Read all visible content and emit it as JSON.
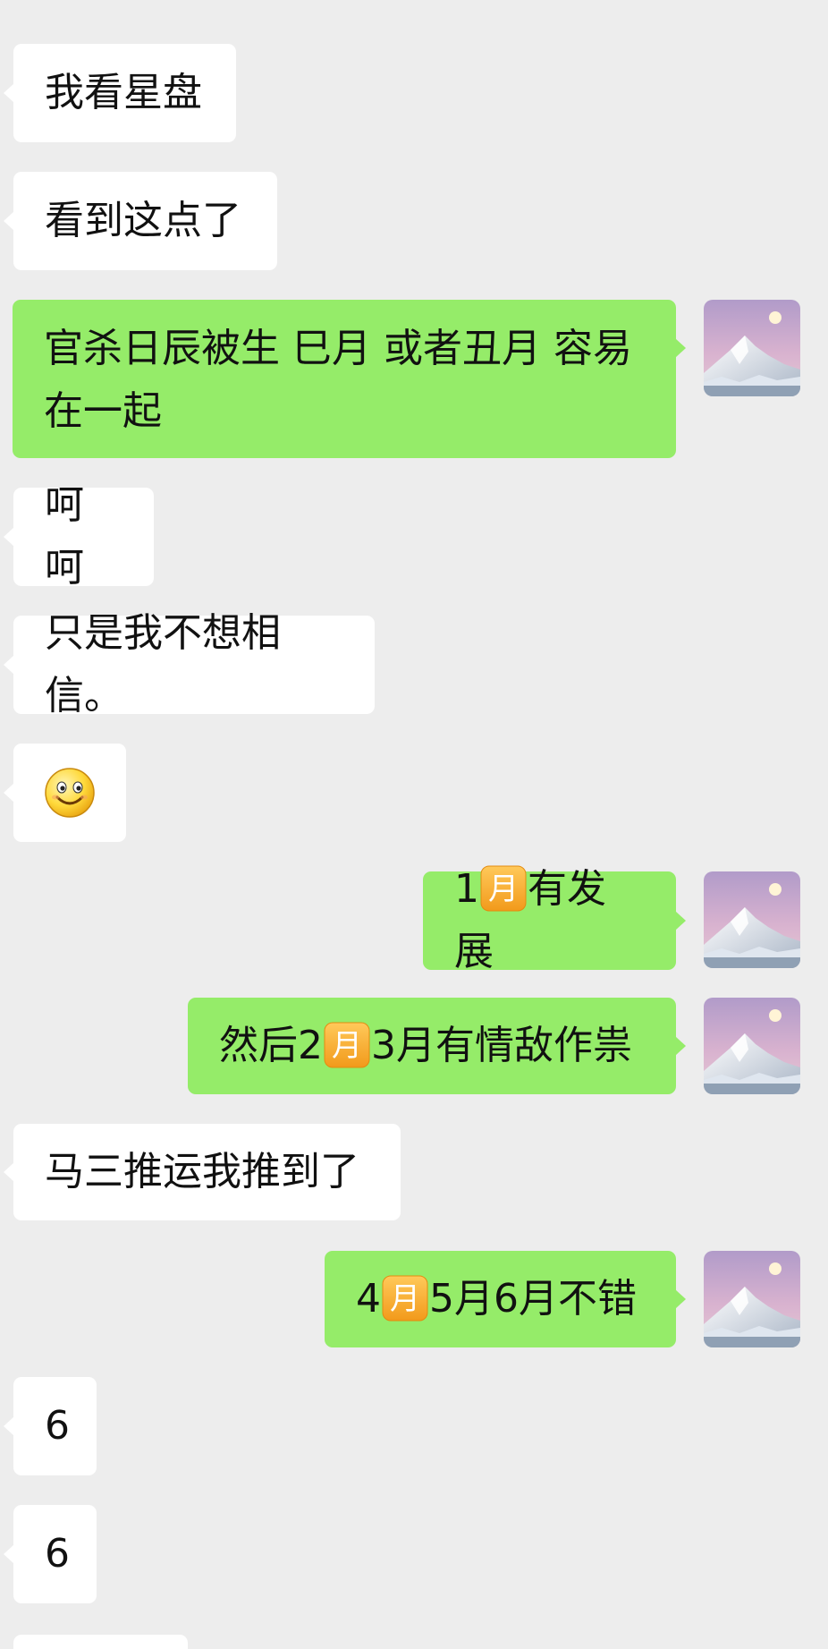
{
  "messages": [
    {
      "side": "in",
      "text": "我看星盘"
    },
    {
      "side": "in",
      "text": "看到这点了"
    },
    {
      "side": "out",
      "line1": "官杀日辰被生 巳月 或者丑月 容易",
      "line2": "在一起"
    },
    {
      "side": "in",
      "text": "呵呵"
    },
    {
      "side": "in",
      "text": "只是我不想相信。"
    },
    {
      "side": "in",
      "emoji": "smiley-icon"
    },
    {
      "side": "out",
      "pre": "1",
      "emoji": "month-icon",
      "emoji_text": "月",
      "post": "有发展"
    },
    {
      "side": "out",
      "pre": "然后2",
      "emoji": "month-icon",
      "emoji_text": "月",
      "post": "3月有情敌作祟"
    },
    {
      "side": "in",
      "text": "马三推运我推到了"
    },
    {
      "side": "out",
      "pre": "4",
      "emoji": "month-icon",
      "emoji_text": "月",
      "post": "5月6月不错"
    },
    {
      "side": "in",
      "text": "6"
    },
    {
      "side": "in",
      "text": "6"
    }
  ],
  "colors": {
    "background": "#ededed",
    "incoming_bubble": "#ffffff",
    "outgoing_bubble": "#95ec69",
    "month_icon": "#f5a623"
  }
}
